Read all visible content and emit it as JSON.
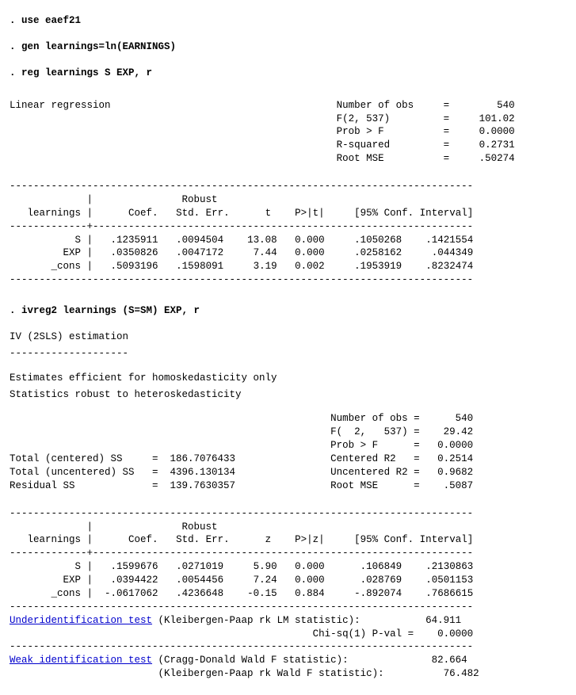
{
  "commands": {
    "use": ". use eaef21",
    "gen": ". gen learnings=ln(EARNINGS)",
    "reg": ". reg learnings S EXP, r",
    "ivreg": ". ivreg2 learnings (S=SM) EXP, r"
  },
  "reg": {
    "title": "Linear regression",
    "stats": {
      "nobs_lbl": "Number of obs",
      "nobs": "540",
      "f_lbl": "F(2, 537)",
      "f": "101.02",
      "p_lbl": "Prob > F",
      "p": "0.0000",
      "r2_lbl": "R-squared",
      "r2": "0.2731",
      "rmse_lbl": "Root MSE",
      "rmse": ".50274"
    },
    "hdr": {
      "dep": "learnings",
      "coef": "Coef.",
      "rob": "Robust",
      "se": "Std. Err.",
      "t": "t",
      "p": "P>|t|",
      "ci": "[95% Conf. Interval]"
    },
    "rows": {
      "s": {
        "n": "S",
        "c": ".1235911",
        "se": ".0094504",
        "t": "13.08",
        "p": "0.000",
        "lo": ".1050268",
        "hi": ".1421554"
      },
      "exp": {
        "n": "EXP",
        "c": ".0350826",
        "se": ".0047172",
        "t": "7.44",
        "p": "0.000",
        "lo": ".0258162",
        "hi": ".044349"
      },
      "con": {
        "n": "_cons",
        "c": ".5093196",
        "se": ".1598091",
        "t": "3.19",
        "p": "0.002",
        "lo": ".1953919",
        "hi": ".8232474"
      }
    }
  },
  "iv": {
    "title": "IV (2SLS) estimation",
    "note1": "Estimates efficient for homoskedasticity only",
    "note2": "Statistics robust to heteroskedasticity",
    "ss": {
      "tcs_lbl": "Total (centered) SS",
      "tcs": "186.7076433",
      "tus_lbl": "Total (uncentered) SS",
      "tus": "4396.130134",
      "rss_lbl": "Residual SS",
      "rss": "139.7630357"
    },
    "stats": {
      "nobs_lbl": "Number of obs",
      "nobs": "540",
      "f_lbl": "F(  2,   537)",
      "f": "29.42",
      "p_lbl": "Prob > F",
      "p": "0.0000",
      "cr2_lbl": "Centered R2",
      "cr2": "0.2514",
      "ur2_lbl": "Uncentered R2",
      "ur2": "0.9682",
      "rmse_lbl": "Root MSE",
      "rmse": ".5087"
    },
    "hdr": {
      "dep": "learnings",
      "coef": "Coef.",
      "rob": "Robust",
      "se": "Std. Err.",
      "z": "z",
      "p": "P>|z|",
      "ci": "[95% Conf. Interval]"
    },
    "rows": {
      "s": {
        "n": "S",
        "c": ".1599676",
        "se": ".0271019",
        "z": "5.90",
        "p": "0.000",
        "lo": ".106849",
        "hi": ".2130863"
      },
      "exp": {
        "n": "EXP",
        "c": ".0394422",
        "se": ".0054456",
        "z": "7.24",
        "p": "0.000",
        "lo": ".028769",
        "hi": ".0501153"
      },
      "con": {
        "n": "_cons",
        "c": "-.0617062",
        "se": ".4236648",
        "z": "-0.15",
        "p": "0.884",
        "lo": "-.892074",
        "hi": ".7686615"
      }
    },
    "tests": {
      "uid_lbl": "Underidentification test",
      "uid_txt": " (Kleibergen-Paap rk LM statistic):",
      "uid_val": "64.911",
      "chi_lbl": "Chi-sq(1) P-val =",
      "chi_val": "0.0000",
      "wid_lbl": "Weak identification test",
      "wid1_txt": " (Cragg-Donald Wald F statistic):",
      "wid1_val": "82.664",
      "wid2_txt": "(Kleibergen-Paap rk Wald F statistic):",
      "wid2_val": "76.482"
    }
  }
}
